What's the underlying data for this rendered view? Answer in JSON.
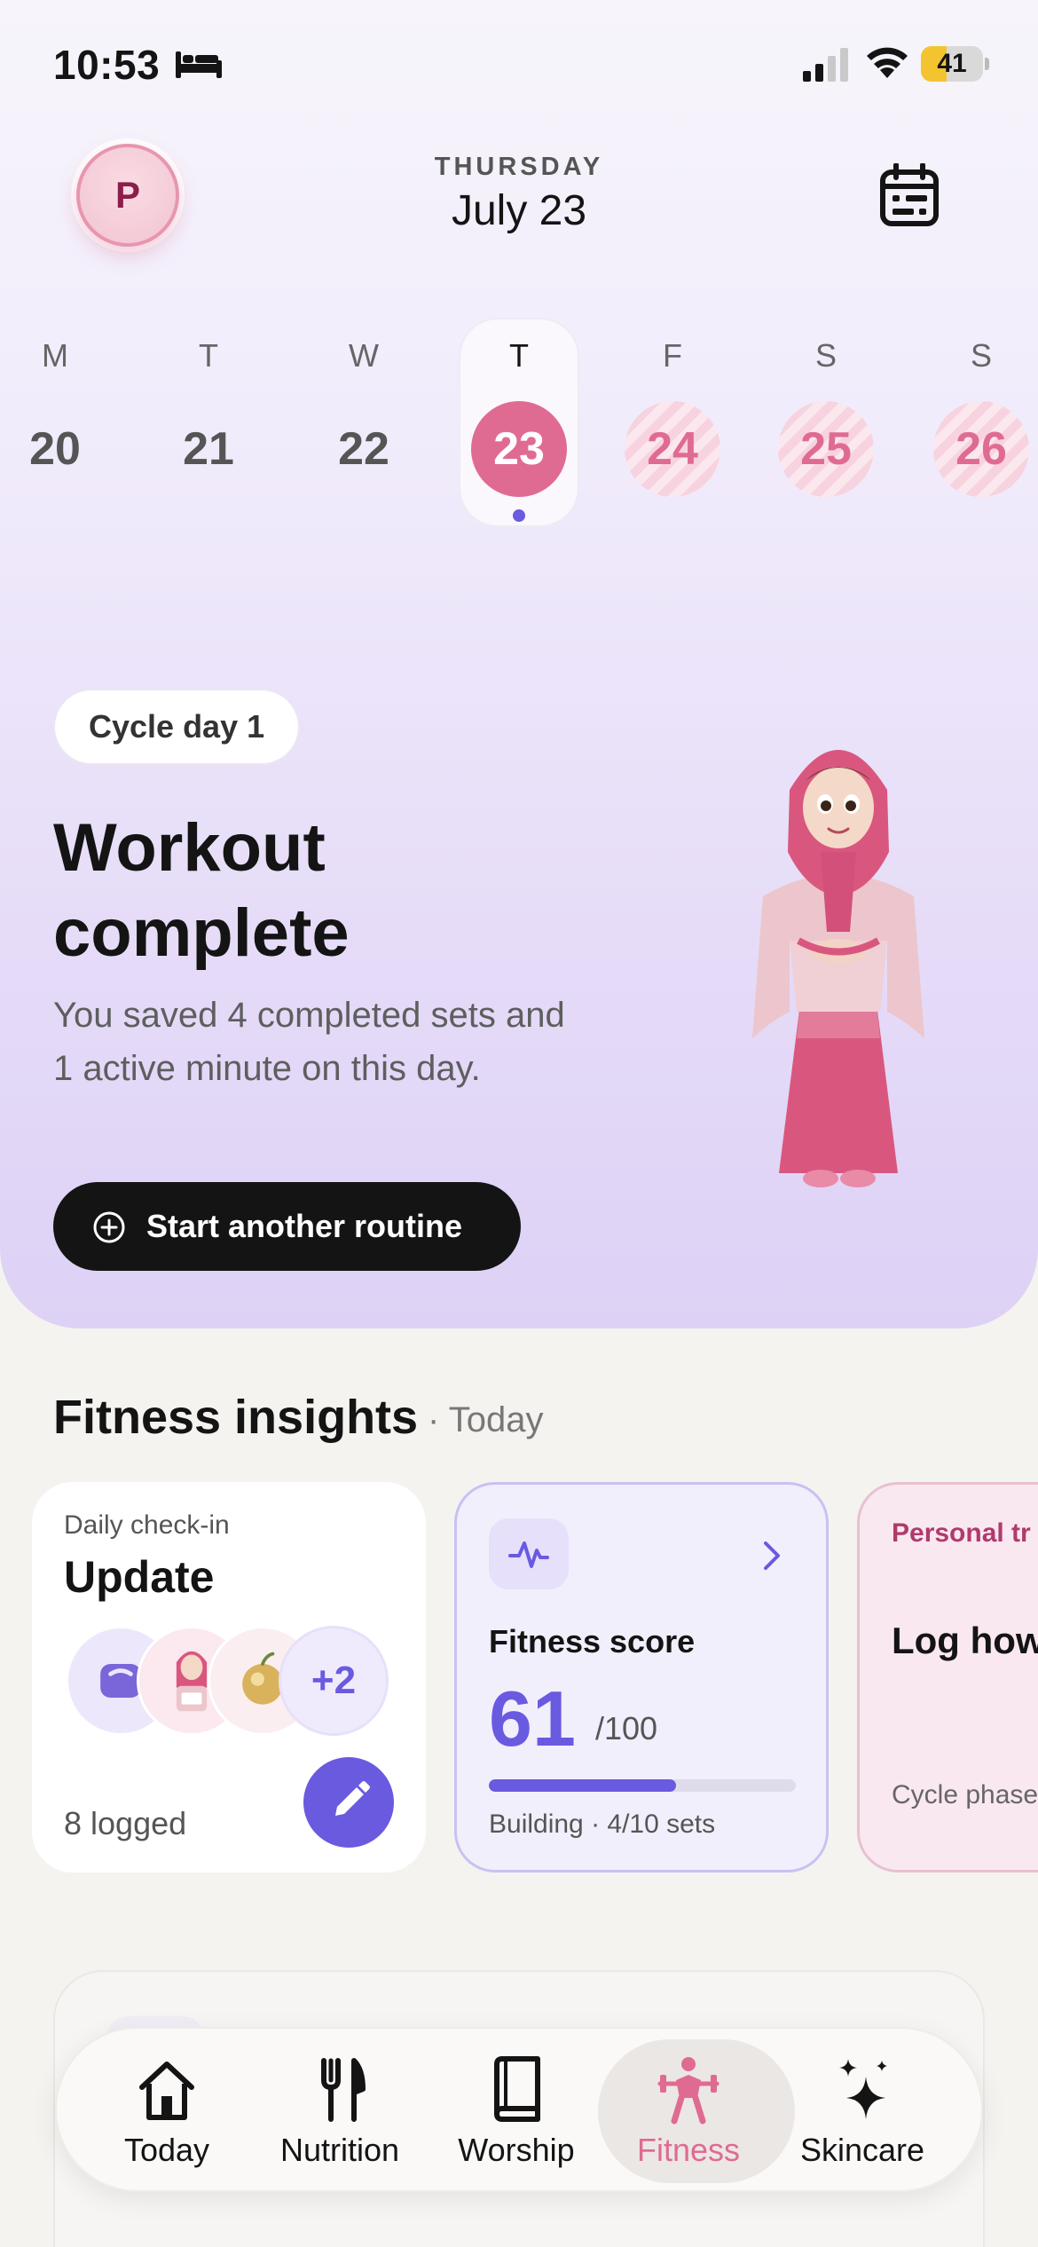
{
  "status": {
    "time": "10:53",
    "battery_level": "41",
    "battery_fraction": 0.41
  },
  "header": {
    "avatar_initial": "P",
    "day_name": "THURSDAY",
    "date": "July 23"
  },
  "week": [
    {
      "letter": "M",
      "number": "20",
      "state": "past"
    },
    {
      "letter": "T",
      "number": "21",
      "state": "past"
    },
    {
      "letter": "W",
      "number": "22",
      "state": "past"
    },
    {
      "letter": "T",
      "number": "23",
      "state": "selected"
    },
    {
      "letter": "F",
      "number": "24",
      "state": "future"
    },
    {
      "letter": "S",
      "number": "25",
      "state": "future"
    },
    {
      "letter": "S",
      "number": "26",
      "state": "future"
    }
  ],
  "hero": {
    "cycle_pill": "Cycle day 1",
    "title": "Workout complete",
    "subtitle": "You saved 4 completed sets and 1 active minute on this day.",
    "cta_label": "Start another routine"
  },
  "insights": {
    "title": "Fitness insights",
    "subtitle": "· Today",
    "checkin": {
      "small": "Daily check-in",
      "title": "Update",
      "more": "+2",
      "logged": "8 logged"
    },
    "score": {
      "label": "Fitness score",
      "value": "61",
      "max": "/100",
      "progress": 0.61,
      "footer": "Building · 4/10 sets"
    },
    "personal": {
      "small": "Personal tr",
      "title": "Log how workout",
      "footer": "Cycle phase available fo"
    }
  },
  "tabs": [
    {
      "label": "Today",
      "icon": "house-icon"
    },
    {
      "label": "Nutrition",
      "icon": "fork-knife-icon"
    },
    {
      "label": "Worship",
      "icon": "book-icon"
    },
    {
      "label": "Fitness",
      "icon": "weightlifter-icon",
      "active": true
    },
    {
      "label": "Skincare",
      "icon": "sparkle-icon"
    }
  ],
  "colors": {
    "accent": "#6a5ae0",
    "pink": "#e06b92",
    "dark": "#141414"
  }
}
